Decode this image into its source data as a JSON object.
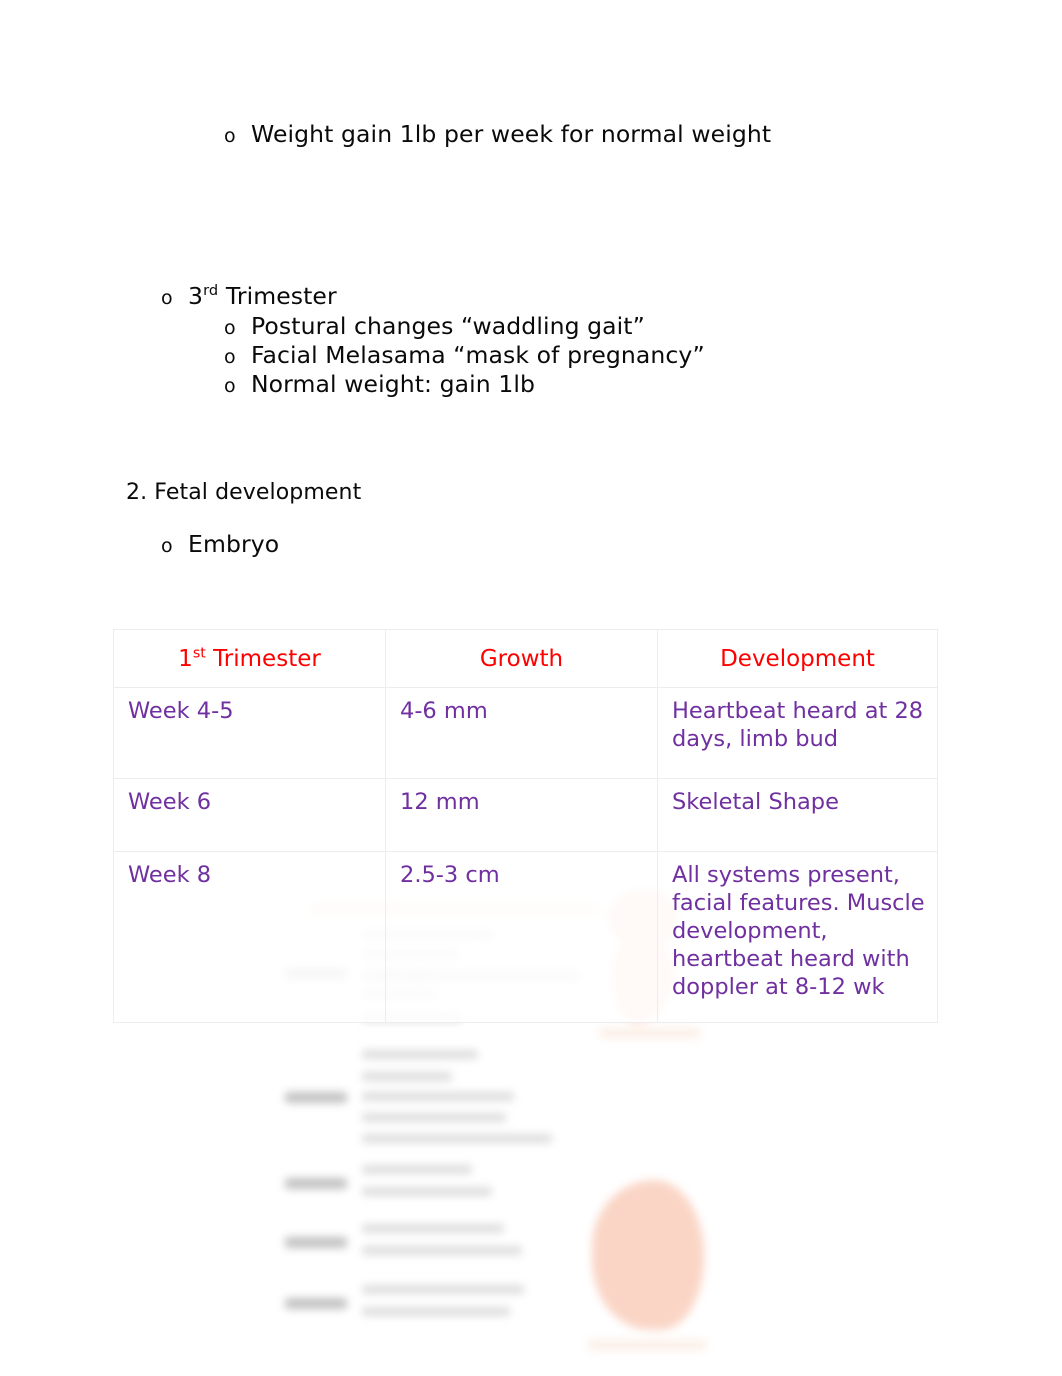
{
  "document": {
    "outline": [
      {
        "id": "weight-gain",
        "marker": "o",
        "text": "Weight gain 1lb per week for normal weight",
        "indent": 1
      },
      {
        "id": "third-trimester",
        "marker": "o",
        "text_before_sup": "3",
        "sup": "rd",
        "text_after_sup": " Trimester",
        "indent": 1
      },
      {
        "id": "postural-changes",
        "marker": "o",
        "text": "Postural changes “waddling gait”",
        "indent": 2
      },
      {
        "id": "facial-melasama",
        "marker": "o",
        "text": "Facial Melasama “mask of pregnancy”",
        "indent": 2
      },
      {
        "id": "normal-weight",
        "marker": "o",
        "text": "Normal weight: gain 1lb",
        "indent": 2
      }
    ],
    "section_heading": "2. Fetal development",
    "embryo_bullet": {
      "marker": "o",
      "text": "Embryo"
    }
  },
  "table": {
    "headers": [
      {
        "text_before_sup": "1",
        "sup": "st",
        "text_after_sup": " Trimester"
      },
      {
        "text_before_sup": "Growth",
        "sup": "",
        "text_after_sup": ""
      },
      {
        "text_before_sup": "Development",
        "sup": "",
        "text_after_sup": ""
      }
    ],
    "header_text_plain": [
      "1st Trimester",
      "Growth",
      "Development"
    ],
    "rows": [
      {
        "week": "Week 4-5",
        "growth": "4-6 mm",
        "development": "Heartbeat heard at 28 days, limb bud"
      },
      {
        "week": "Week 6",
        "growth": "12 mm",
        "development": "Skeletal Shape"
      },
      {
        "week": "Week 8",
        "growth": "2.5-3 cm",
        "development": "All systems present, facial features. Muscle development, heartbeat heard with doppler at 8-12 wk"
      }
    ]
  },
  "colors": {
    "header_red": "#ff0000",
    "body_purple": "#7030a0",
    "text_black": "#0a0a0a",
    "table_border": "#ededed",
    "embryo_orange": "#f08050"
  },
  "background_image": {
    "description": "faded blurred embryo development chart illustration",
    "visible": true
  }
}
